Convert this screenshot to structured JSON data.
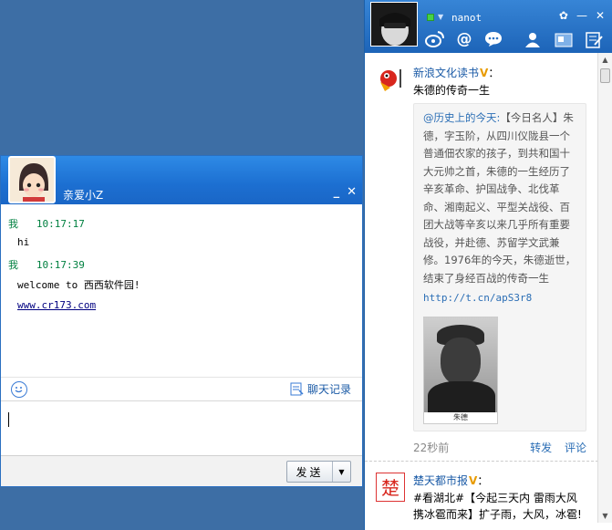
{
  "chat": {
    "title": "亲爱小Z",
    "minimize": "_",
    "close": "✕",
    "messages": [
      {
        "sender": "我",
        "time": "10:17:17",
        "lines": [
          "hi"
        ]
      },
      {
        "sender": "我",
        "time": "10:17:39",
        "text": "welcome to 西西软件园!",
        "link": "www.cr173.com"
      }
    ],
    "history_label": "聊天记录",
    "send_label": "发送"
  },
  "weibo": {
    "username": "nanot",
    "post1": {
      "author": "新浪文化读书",
      "verified": "V",
      "colon": "：",
      "text": "朱德的传奇一生",
      "quote_mention": "@历史上的今天:",
      "quote_text": "【今日名人】朱德，字玉阶，从四川仪陇县一个普通佃农家的孩子，到共和国十大元帅之首，朱德的一生经历了辛亥革命、护国战争、北伐革命、湘南起义、平型关战役、百团大战等辛亥以来几乎所有重要战役，并赴德、苏留学文武兼修。1976年的今天，朱德逝世，结束了身经百战的传奇一生",
      "quote_url": "http://t.cn/apS3r8",
      "photo_caption": "朱德",
      "time": "22秒前",
      "repost": "转发",
      "comment": "评论"
    },
    "post2": {
      "author": "楚天都市报",
      "verified": "V",
      "colon": "：",
      "text": "#看湖北#【今起三天内 雷雨大风携冰雹而来】扩子雨，大风，冰雹!"
    }
  }
}
